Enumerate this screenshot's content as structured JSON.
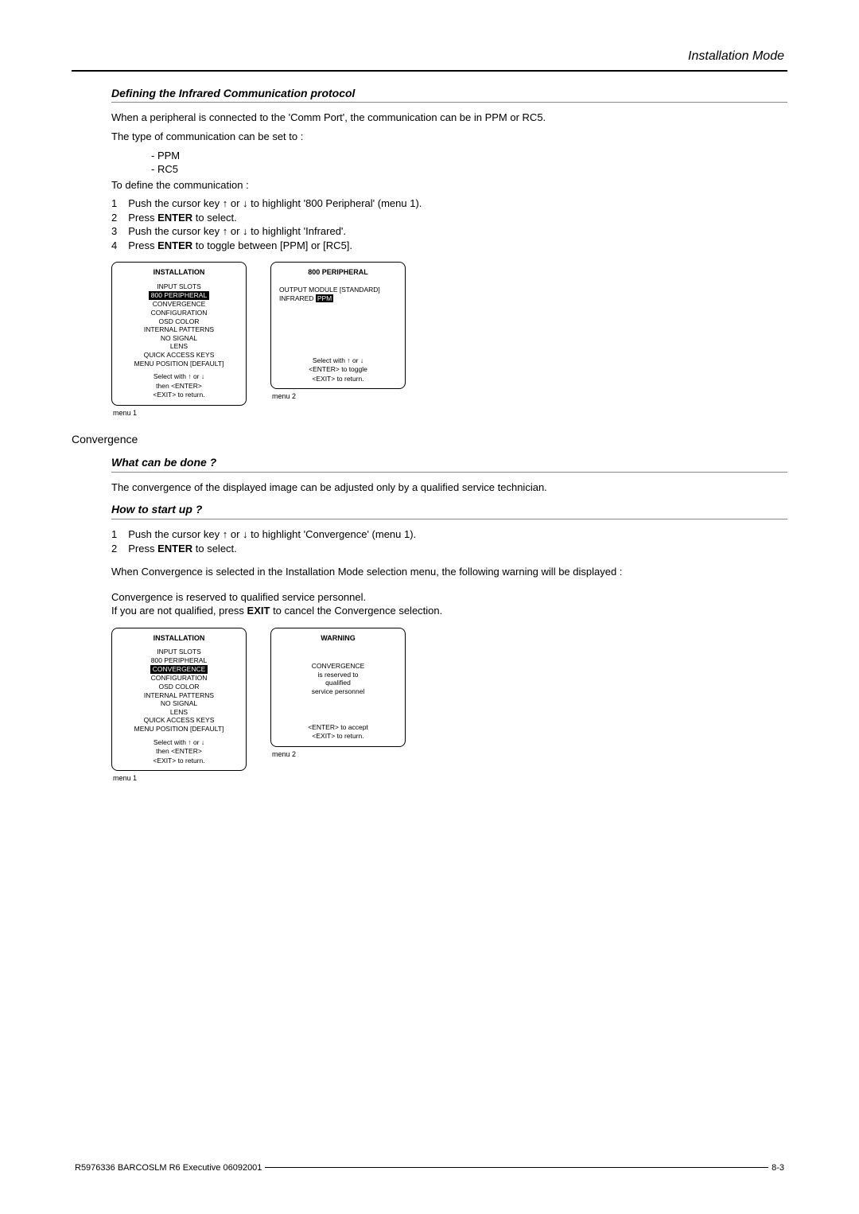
{
  "header": {
    "title": "Installation Mode"
  },
  "section1": {
    "title": "Defining the Infrared Communication protocol",
    "p1": "When a peripheral is connected to the 'Comm Port', the communication can be in PPM or RC5.",
    "p2": "The type of communication can be set to :",
    "bullets": [
      "- PPM",
      "- RC5"
    ],
    "p3": "To define the communication :",
    "steps": [
      {
        "n": "1",
        "pre": "Push the cursor key ",
        "post": " to highlight '800 Peripheral' (menu 1)."
      },
      {
        "n": "2",
        "pre": "Press ",
        "bold": "ENTER",
        "post": " to select."
      },
      {
        "n": "3",
        "pre": "Push the cursor key ",
        "post": " to highlight 'Infrared'."
      },
      {
        "n": "4",
        "pre": "Press ",
        "bold": "ENTER",
        "post": " to toggle between [PPM] or [RC5]."
      }
    ],
    "menu1": {
      "title": "INSTALLATION",
      "items": [
        "INPUT SLOTS",
        "800 PERIPHERAL",
        "CONVERGENCE",
        "CONFIGURATION",
        "OSD COLOR",
        "INTERNAL PATTERNS",
        "NO SIGNAL",
        "LENS",
        "QUICK ACCESS KEYS",
        "MENU POSITION [DEFAULT]"
      ],
      "highlight_index": 1,
      "footer": [
        "Select with ↑ or ↓",
        "then <ENTER>",
        "<EXIT> to return."
      ],
      "caption": "menu 1"
    },
    "menu2": {
      "title": "800 PERIPHERAL",
      "line1_label": "OUTPUT MODULE",
      "line1_val": "[STANDARD]",
      "line2_label": "INFRARED",
      "line2_val": "PPM",
      "footer": [
        "Select with ↑ or ↓",
        "<ENTER> to toggle",
        "<EXIT> to return."
      ],
      "caption": "menu 2"
    }
  },
  "section2": {
    "heading": "Convergence",
    "sub1_title": "What can be done ?",
    "sub1_p": "The convergence of the displayed image can be adjusted only by a qualified service technician.",
    "sub2_title": "How to start up ?",
    "steps": [
      {
        "n": "1",
        "pre": "Push the cursor key ",
        "post": " to highlight 'Convergence' (menu 1)."
      },
      {
        "n": "2",
        "pre": "Press ",
        "bold": "ENTER",
        "post": " to select."
      }
    ],
    "p_after": "When Convergence is selected in the Installation Mode selection menu, the following warning will be displayed :",
    "p_warn1": "Convergence is reserved to qualified service personnel.",
    "p_warn2_pre": "If you are not qualified, press ",
    "p_warn2_bold": "EXIT",
    "p_warn2_post": " to cancel the Convergence selection.",
    "menu1": {
      "title": "INSTALLATION",
      "items": [
        "INPUT SLOTS",
        "800 PERIPHERAL",
        "CONVERGENCE",
        "CONFIGURATION",
        "OSD COLOR",
        "INTERNAL PATTERNS",
        "NO SIGNAL",
        "LENS",
        "QUICK ACCESS KEYS",
        "MENU POSITION [DEFAULT]"
      ],
      "highlight_index": 2,
      "footer": [
        "Select with ↑ or ↓",
        "then <ENTER>",
        "<EXIT> to return."
      ],
      "caption": "menu 1"
    },
    "menu2": {
      "title": "WARNING",
      "body": [
        "CONVERGENCE",
        "is reserved to",
        "qualified",
        "service personnel"
      ],
      "footer": [
        "<ENTER> to accept",
        "<EXIT> to return."
      ],
      "caption": "menu 2"
    }
  },
  "footer": {
    "left": "R5976336 BARCOSLM R6 Executive 06092001",
    "right": "8-3"
  }
}
